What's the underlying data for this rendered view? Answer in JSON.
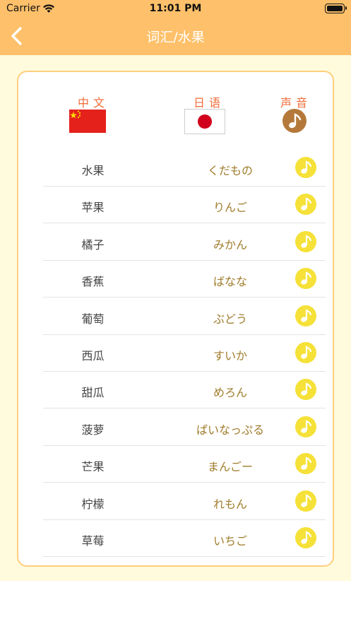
{
  "status": {
    "carrier": "Carrier",
    "time": "11:01 PM"
  },
  "nav": {
    "title": "词汇/水果"
  },
  "headers": {
    "chinese": "中文",
    "japanese": "日语",
    "sound": "声音"
  },
  "colors": {
    "header_bg": "#fec06a",
    "content_bg": "#fffbdc",
    "card_border": "#fecf7e",
    "heading": "#f06b3a",
    "japanese_text": "#a07c2c",
    "play_button": "#f5e138",
    "sound_icon": "#b4793a"
  },
  "icons": {
    "back": "chevron-left-icon",
    "cn_flag": "china-flag-icon",
    "jp_flag": "japan-flag-icon",
    "sound": "music-note-icon"
  },
  "words": [
    {
      "zh": "水果",
      "ja": "くだもの"
    },
    {
      "zh": "苹果",
      "ja": "りんご"
    },
    {
      "zh": "橘子",
      "ja": "みかん"
    },
    {
      "zh": "香蕉",
      "ja": "ばなな"
    },
    {
      "zh": "葡萄",
      "ja": "ぶどう"
    },
    {
      "zh": "西瓜",
      "ja": "すいか"
    },
    {
      "zh": "甜瓜",
      "ja": "めろん"
    },
    {
      "zh": "菠萝",
      "ja": "ぱいなっぷる"
    },
    {
      "zh": "芒果",
      "ja": "まんごー"
    },
    {
      "zh": "柠檬",
      "ja": "れもん"
    },
    {
      "zh": "草莓",
      "ja": "いちご"
    }
  ]
}
